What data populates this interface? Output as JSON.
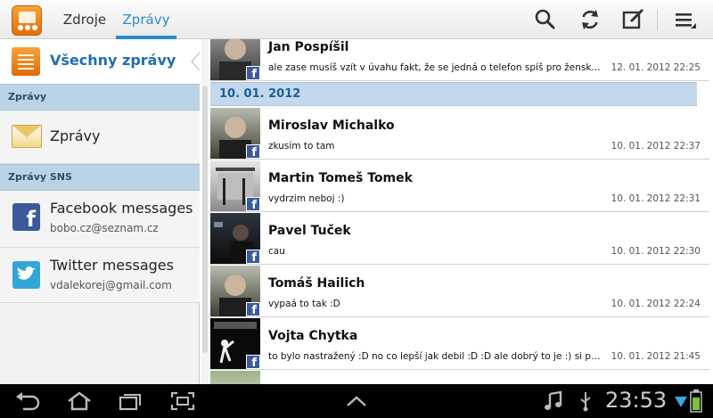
{
  "tabs": [
    {
      "label": "Zdroje",
      "active": false
    },
    {
      "label": "Zprávy",
      "active": true
    }
  ],
  "colors": {
    "accent": "#2a8bd0",
    "section": "#bcd3e6",
    "facebook": "#3b5a9a",
    "twitter": "#33a6d8"
  },
  "actionbar_icons": [
    "search-icon",
    "refresh-icon",
    "compose-icon",
    "overflow-menu-icon"
  ],
  "sidebar": {
    "all_label": "Všechny zprávy",
    "sections": [
      {
        "title": "Zprávy",
        "items": [
          {
            "label": "Zprávy",
            "icon": "envelope-icon"
          }
        ]
      },
      {
        "title": "Zprávy SNS",
        "items": [
          {
            "label": "Facebook messages",
            "sub": "bobo.cz@seznam.cz",
            "icon": "facebook-icon"
          },
          {
            "label": "Twitter messages",
            "sub": "vdalekorej@gmail.com",
            "icon": "twitter-icon"
          }
        ]
      }
    ]
  },
  "messages_top": {
    "name": "Jan Pospíšil",
    "text": "ale zase musíš vzít v úvahu fakt, že se jedná o telefon spíš pro ženský a je...",
    "time": "12. 01. 2012 22:25"
  },
  "date_group": "10. 01. 2012",
  "messages": [
    {
      "name": "Miroslav Michalko",
      "text": "zkusím to tam",
      "time": "10. 01. 2012 22:37"
    },
    {
      "name": "Martin Tomeš Tomek",
      "text": "vydrzim neboj :)",
      "time": "10. 01. 2012 22:31"
    },
    {
      "name": "Pavel Tuček",
      "text": "cau",
      "time": "10. 01. 2012 22:30"
    },
    {
      "name": "Tomáš Hailich",
      "text": "vypaá to tak :D",
      "time": "10. 01. 2012 22:24"
    },
    {
      "name": "Vojta Chytka",
      "text": "to bylo nastražený :D no co lepší jak debil :D :D ale dobrý to je :) si pučim...",
      "time": "10. 01. 2012 21:45"
    }
  ],
  "status": {
    "clock": "23:53"
  },
  "system_icons": [
    "back-icon",
    "home-icon",
    "recent-apps-icon",
    "screenshot-icon",
    "up-arrow-icon",
    "music-icon",
    "usb-icon",
    "wifi-icon",
    "battery-icon"
  ]
}
